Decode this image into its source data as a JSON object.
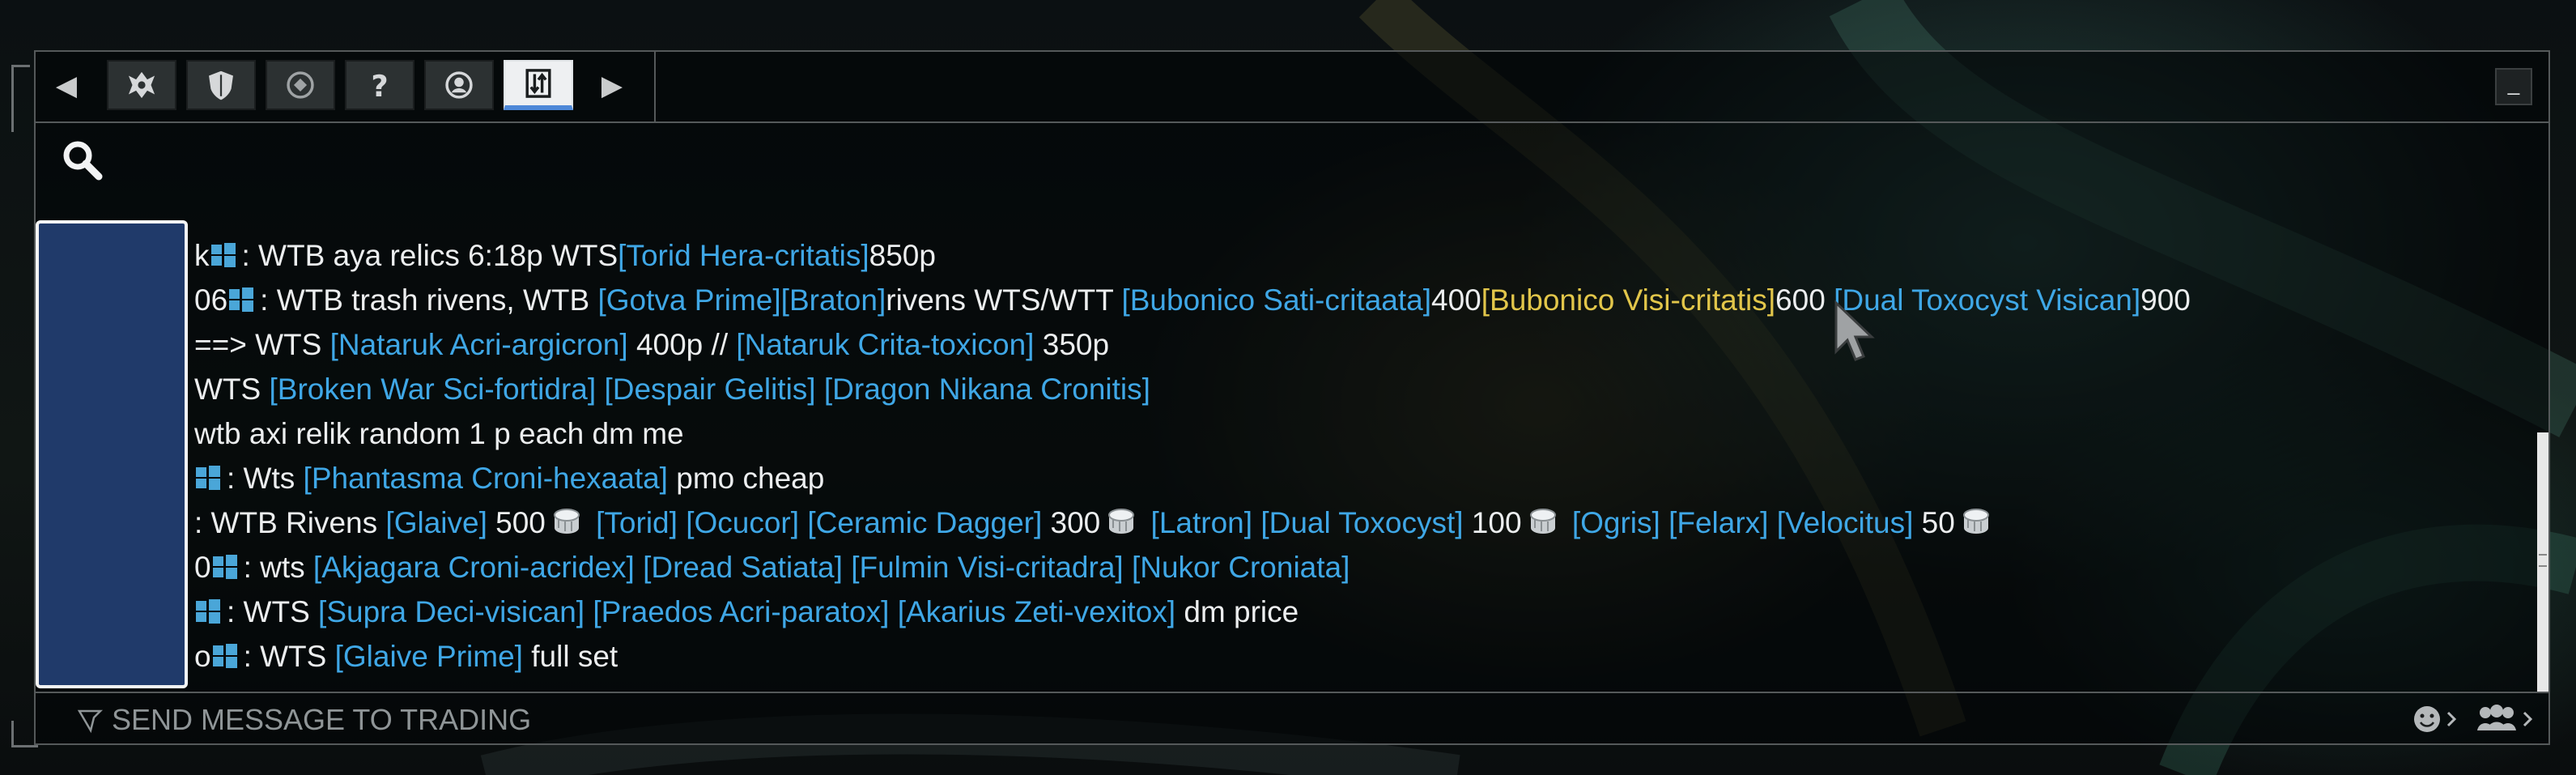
{
  "tabs": [
    {
      "id": "clan",
      "icon": "clan-sigil-icon"
    },
    {
      "id": "alliance",
      "icon": "shield-icon"
    },
    {
      "id": "recruiting",
      "icon": "recruiting-emblem-icon"
    },
    {
      "id": "help",
      "icon": "question-mark-icon"
    },
    {
      "id": "region",
      "icon": "lotus-icon"
    },
    {
      "id": "trading",
      "icon": "trade-arrows-icon",
      "active": true
    }
  ],
  "nav": {
    "prev_icon": "chevron-left-icon",
    "next_icon": "chevron-right-icon"
  },
  "window": {
    "minimize_label": "_"
  },
  "search": {
    "icon": "search-icon"
  },
  "messages": [
    [
      {
        "t": "k",
        "s": "n"
      },
      {
        "t": "",
        "s": "p"
      },
      {
        "t": ": WTB aya relics 6:18p WTS",
        "s": "n"
      },
      {
        "t": "[Torid Hera-critatis]",
        "s": "l"
      },
      {
        "t": "850p",
        "s": "n"
      }
    ],
    [
      {
        "t": "06",
        "s": "n"
      },
      {
        "t": "",
        "s": "p"
      },
      {
        "t": ": WTB trash rivens, WTB ",
        "s": "n"
      },
      {
        "t": "[Gotva Prime]",
        "s": "l"
      },
      {
        "t": "[Braton]",
        "s": "l"
      },
      {
        "t": "rivens WTS/WTT ",
        "s": "n"
      },
      {
        "t": "[Bubonico Sati-critaata]",
        "s": "l"
      },
      {
        "t": "400",
        "s": "n"
      },
      {
        "t": "[Bubonico Visi-critatis]",
        "s": "h"
      },
      {
        "t": "600 ",
        "s": "n"
      },
      {
        "t": "[Dual Toxocyst Visican]",
        "s": "l"
      },
      {
        "t": "900",
        "s": "n"
      }
    ],
    [
      {
        "t": "==> WTS ",
        "s": "n"
      },
      {
        "t": "[Nataruk Acri-argicron]",
        "s": "l"
      },
      {
        "t": " 400p // ",
        "s": "n"
      },
      {
        "t": "[Nataruk Crita-toxicon]",
        "s": "l"
      },
      {
        "t": " 350p",
        "s": "n"
      }
    ],
    [
      {
        "t": "WTS ",
        "s": "n"
      },
      {
        "t": "[Broken War Sci-fortidra]",
        "s": "l"
      },
      {
        "t": " ",
        "s": "n"
      },
      {
        "t": "[Despair Gelitis]",
        "s": "l"
      },
      {
        "t": " ",
        "s": "n"
      },
      {
        "t": "[Dragon Nikana Cronitis]",
        "s": "l"
      }
    ],
    [
      {
        "t": " wtb axi relik random 1 p each dm me",
        "s": "n"
      }
    ],
    [
      {
        "t": "",
        "s": "p"
      },
      {
        "t": ": Wts ",
        "s": "n"
      },
      {
        "t": "[Phantasma Croni-hexaata]",
        "s": "l"
      },
      {
        "t": " pmo cheap",
        "s": "n"
      }
    ],
    [
      {
        "t": ": WTB Rivens ",
        "s": "n"
      },
      {
        "t": "[Glaive]",
        "s": "l"
      },
      {
        "t": " 500",
        "s": "n"
      },
      {
        "t": "",
        "s": "c"
      },
      {
        "t": " ",
        "s": "n"
      },
      {
        "t": "[Torid]",
        "s": "l"
      },
      {
        "t": " ",
        "s": "n"
      },
      {
        "t": "[Ocucor]",
        "s": "l"
      },
      {
        "t": " ",
        "s": "n"
      },
      {
        "t": "[Ceramic Dagger]",
        "s": "l"
      },
      {
        "t": " 300",
        "s": "n"
      },
      {
        "t": "",
        "s": "c"
      },
      {
        "t": " ",
        "s": "n"
      },
      {
        "t": "[Latron]",
        "s": "l"
      },
      {
        "t": " ",
        "s": "n"
      },
      {
        "t": "[Dual Toxocyst]",
        "s": "l"
      },
      {
        "t": " 100",
        "s": "n"
      },
      {
        "t": "",
        "s": "c"
      },
      {
        "t": " ",
        "s": "n"
      },
      {
        "t": "[Ogris]",
        "s": "l"
      },
      {
        "t": " ",
        "s": "n"
      },
      {
        "t": "[Felarx]",
        "s": "l"
      },
      {
        "t": " ",
        "s": "n"
      },
      {
        "t": "[Velocitus]",
        "s": "l"
      },
      {
        "t": " 50",
        "s": "n"
      },
      {
        "t": "",
        "s": "c"
      }
    ],
    [
      {
        "t": "0",
        "s": "n"
      },
      {
        "t": "",
        "s": "p"
      },
      {
        "t": ": wts ",
        "s": "n"
      },
      {
        "t": "[Akjagara Croni-acridex]",
        "s": "l"
      },
      {
        "t": " ",
        "s": "n"
      },
      {
        "t": "[Dread Satiata]",
        "s": "l"
      },
      {
        "t": " ",
        "s": "n"
      },
      {
        "t": "[Fulmin Visi-critadra]",
        "s": "l"
      },
      {
        "t": " ",
        "s": "n"
      },
      {
        "t": "[Nukor Croniata]",
        "s": "l"
      }
    ],
    [
      {
        "t": "",
        "s": "p"
      },
      {
        "t": ": WTS ",
        "s": "n"
      },
      {
        "t": "[Supra Deci-visican]",
        "s": "l"
      },
      {
        "t": " ",
        "s": "n"
      },
      {
        "t": "[Praedos Acri-paratox]",
        "s": "l"
      },
      {
        "t": " ",
        "s": "n"
      },
      {
        "t": "[Akarius Zeti-vexitox]",
        "s": "l"
      },
      {
        "t": " dm price",
        "s": "n"
      }
    ],
    [
      {
        "t": "o",
        "s": "n"
      },
      {
        "t": "",
        "s": "p"
      },
      {
        "t": ": WTS ",
        "s": "n"
      },
      {
        "t": "[Glaive Prime]",
        "s": "l"
      },
      {
        "t": " full set",
        "s": "n"
      }
    ]
  ],
  "input": {
    "placeholder": "SEND MESSAGE TO TRADING",
    "value": ""
  },
  "input_icons": {
    "send": "chat-send-icon",
    "emoji": "emoji-face-icon",
    "squad": "squad-members-icon"
  },
  "colors": {
    "link": "#3fa7e6",
    "highlight_link": "#e2c64a",
    "text": "#eceeef",
    "active_tab_underline": "#4e88d8",
    "redaction_fill": "#203a6a"
  }
}
